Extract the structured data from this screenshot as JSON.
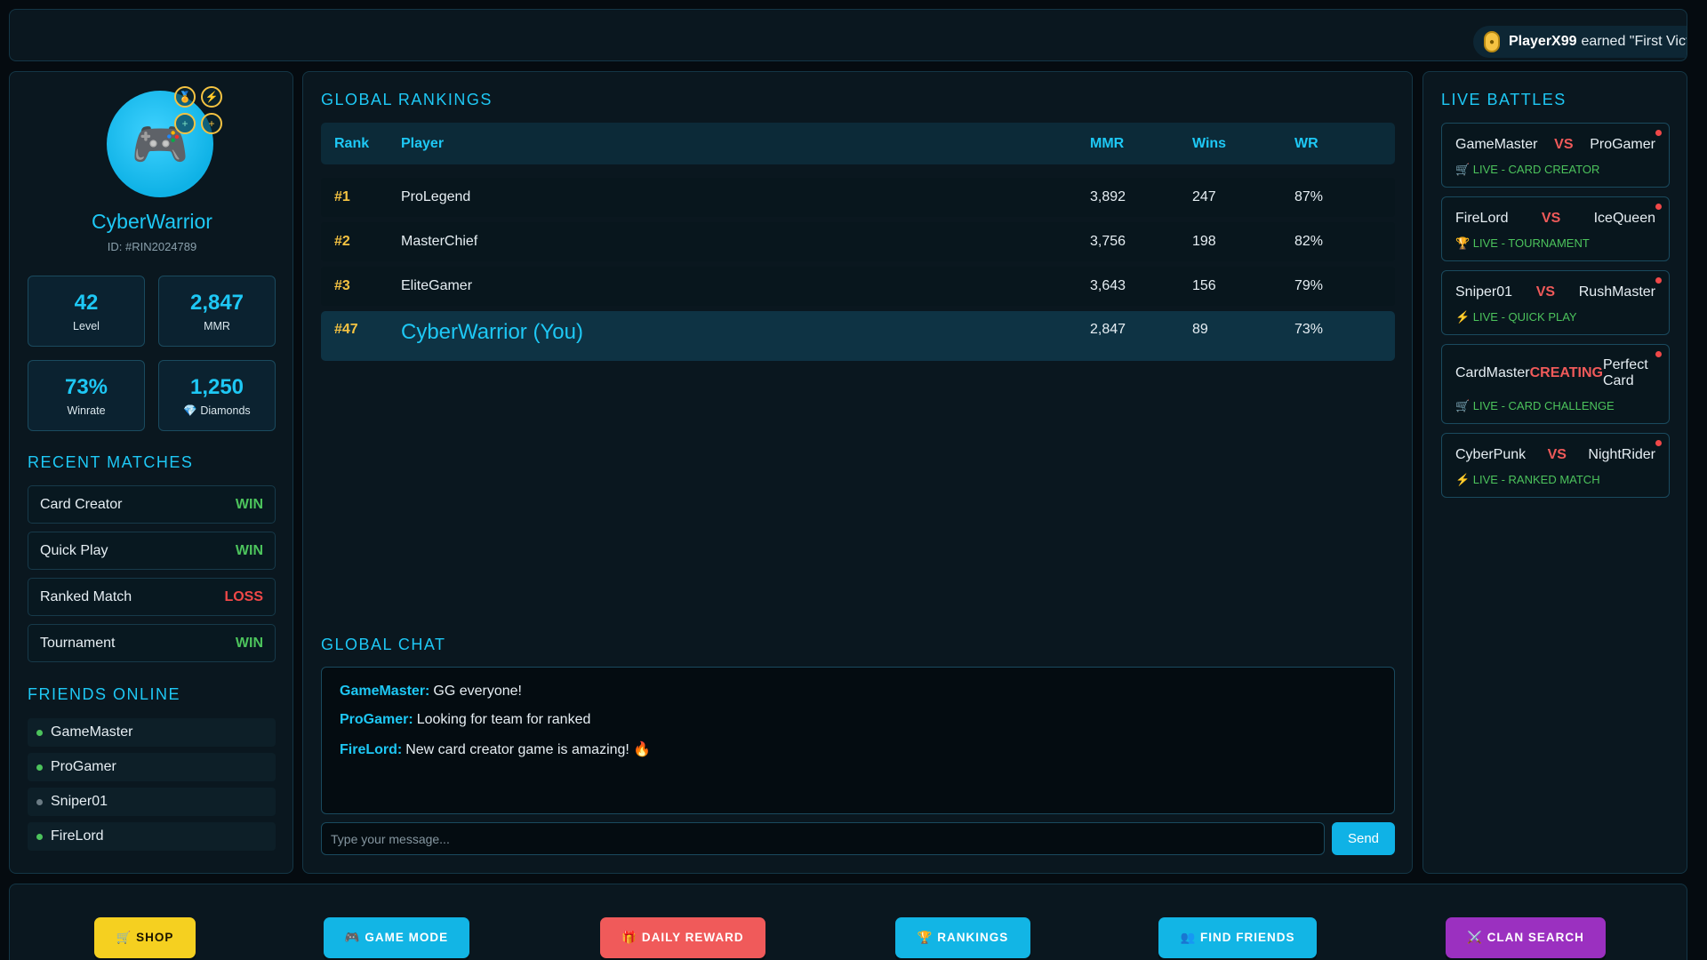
{
  "ticker": {
    "icon": "coin-icon",
    "user": "PlayerX99",
    "text": "earned \"First Victor"
  },
  "profile": {
    "avatar_icon": "gamepad-icon",
    "badges": [
      "medal-icon",
      "lightning-icon",
      "plus-icon",
      "plus-icon"
    ],
    "name": "CyberWarrior",
    "id": "ID: #RIN2024789",
    "stats": [
      {
        "value": "42",
        "label": "Level"
      },
      {
        "value": "2,847",
        "label": "MMR"
      },
      {
        "value": "73%",
        "label": "Winrate"
      },
      {
        "value": "1,250",
        "label": "💎 Diamonds"
      }
    ]
  },
  "recent_matches": {
    "title": "RECENT MATCHES",
    "items": [
      {
        "name": "Card Creator",
        "result": "WIN"
      },
      {
        "name": "Quick Play",
        "result": "WIN"
      },
      {
        "name": "Ranked Match",
        "result": "LOSS"
      },
      {
        "name": "Tournament",
        "result": "WIN"
      }
    ]
  },
  "friends": {
    "title": "FRIENDS ONLINE",
    "items": [
      {
        "name": "GameMaster",
        "status": "online"
      },
      {
        "name": "ProGamer",
        "status": "online"
      },
      {
        "name": "Sniper01",
        "status": "offline"
      },
      {
        "name": "FireLord",
        "status": "online"
      }
    ]
  },
  "rankings": {
    "title": "GLOBAL RANKINGS",
    "headers": {
      "rank": "Rank",
      "player": "Player",
      "mmr": "MMR",
      "wins": "Wins",
      "wr": "WR"
    },
    "rows": [
      {
        "rank": "#1",
        "player": "ProLegend",
        "mmr": "3,892",
        "wins": "247",
        "wr": "87%"
      },
      {
        "rank": "#2",
        "player": "MasterChief",
        "mmr": "3,756",
        "wins": "198",
        "wr": "82%"
      },
      {
        "rank": "#3",
        "player": "EliteGamer",
        "mmr": "3,643",
        "wins": "156",
        "wr": "79%"
      },
      {
        "rank": "#47",
        "player": "CyberWarrior (You)",
        "mmr": "2,847",
        "wins": "89",
        "wr": "73%"
      }
    ]
  },
  "chat": {
    "title": "GLOBAL CHAT",
    "messages": [
      {
        "user": "GameMaster:",
        "text": "GG everyone!"
      },
      {
        "user": "ProGamer:",
        "text": "Looking for team for ranked"
      },
      {
        "user": "FireLord:",
        "text": "New card creator game is amazing! 🔥"
      }
    ],
    "placeholder": "Type your message...",
    "send_label": "Send"
  },
  "live_battles": {
    "title": "LIVE BATTLES",
    "items": [
      {
        "p1": "GameMaster",
        "vs": "VS",
        "p2": "ProGamer",
        "mode": "🛒 LIVE - CARD CREATOR"
      },
      {
        "p1": "FireLord",
        "vs": "VS",
        "p2": "IceQueen",
        "mode": "🏆 LIVE - TOURNAMENT"
      },
      {
        "p1": "Sniper01",
        "vs": "VS",
        "p2": "RushMaster",
        "mode": "⚡ LIVE - QUICK PLAY"
      },
      {
        "p1": "CardMaster",
        "vs": "CREATING",
        "p2": "Perfect Card",
        "mode": "🛒 LIVE - CARD CHALLENGE"
      },
      {
        "p1": "CyberPunk",
        "vs": "VS",
        "p2": "NightRider",
        "mode": "⚡ LIVE - RANKED MATCH"
      }
    ]
  },
  "bottom_nav": [
    {
      "label": "🛒 SHOP",
      "color": "#f5d020",
      "text_color": "#1a1400"
    },
    {
      "label": "🎮 GAME MODE",
      "color": "#12b5e5",
      "text_color": "#ffffff"
    },
    {
      "label": "🎁 DAILY REWARD",
      "color": "#f05a5a",
      "text_color": "#ffffff"
    },
    {
      "label": "🏆 RANKINGS",
      "color": "#12b5e5",
      "text_color": "#ffffff"
    },
    {
      "label": "👥 FIND FRIENDS",
      "color": "#12b5e5",
      "text_color": "#ffffff"
    },
    {
      "label": "⚔️ CLAN SEARCH",
      "color": "#9b30c0",
      "text_color": "#ffffff"
    }
  ],
  "colors": {
    "accent": "#1ec8f5",
    "win": "#4cc35c",
    "loss": "#f04848",
    "gold": "#f5c342",
    "online": "#4cc35c",
    "offline": "#6b7b84"
  }
}
